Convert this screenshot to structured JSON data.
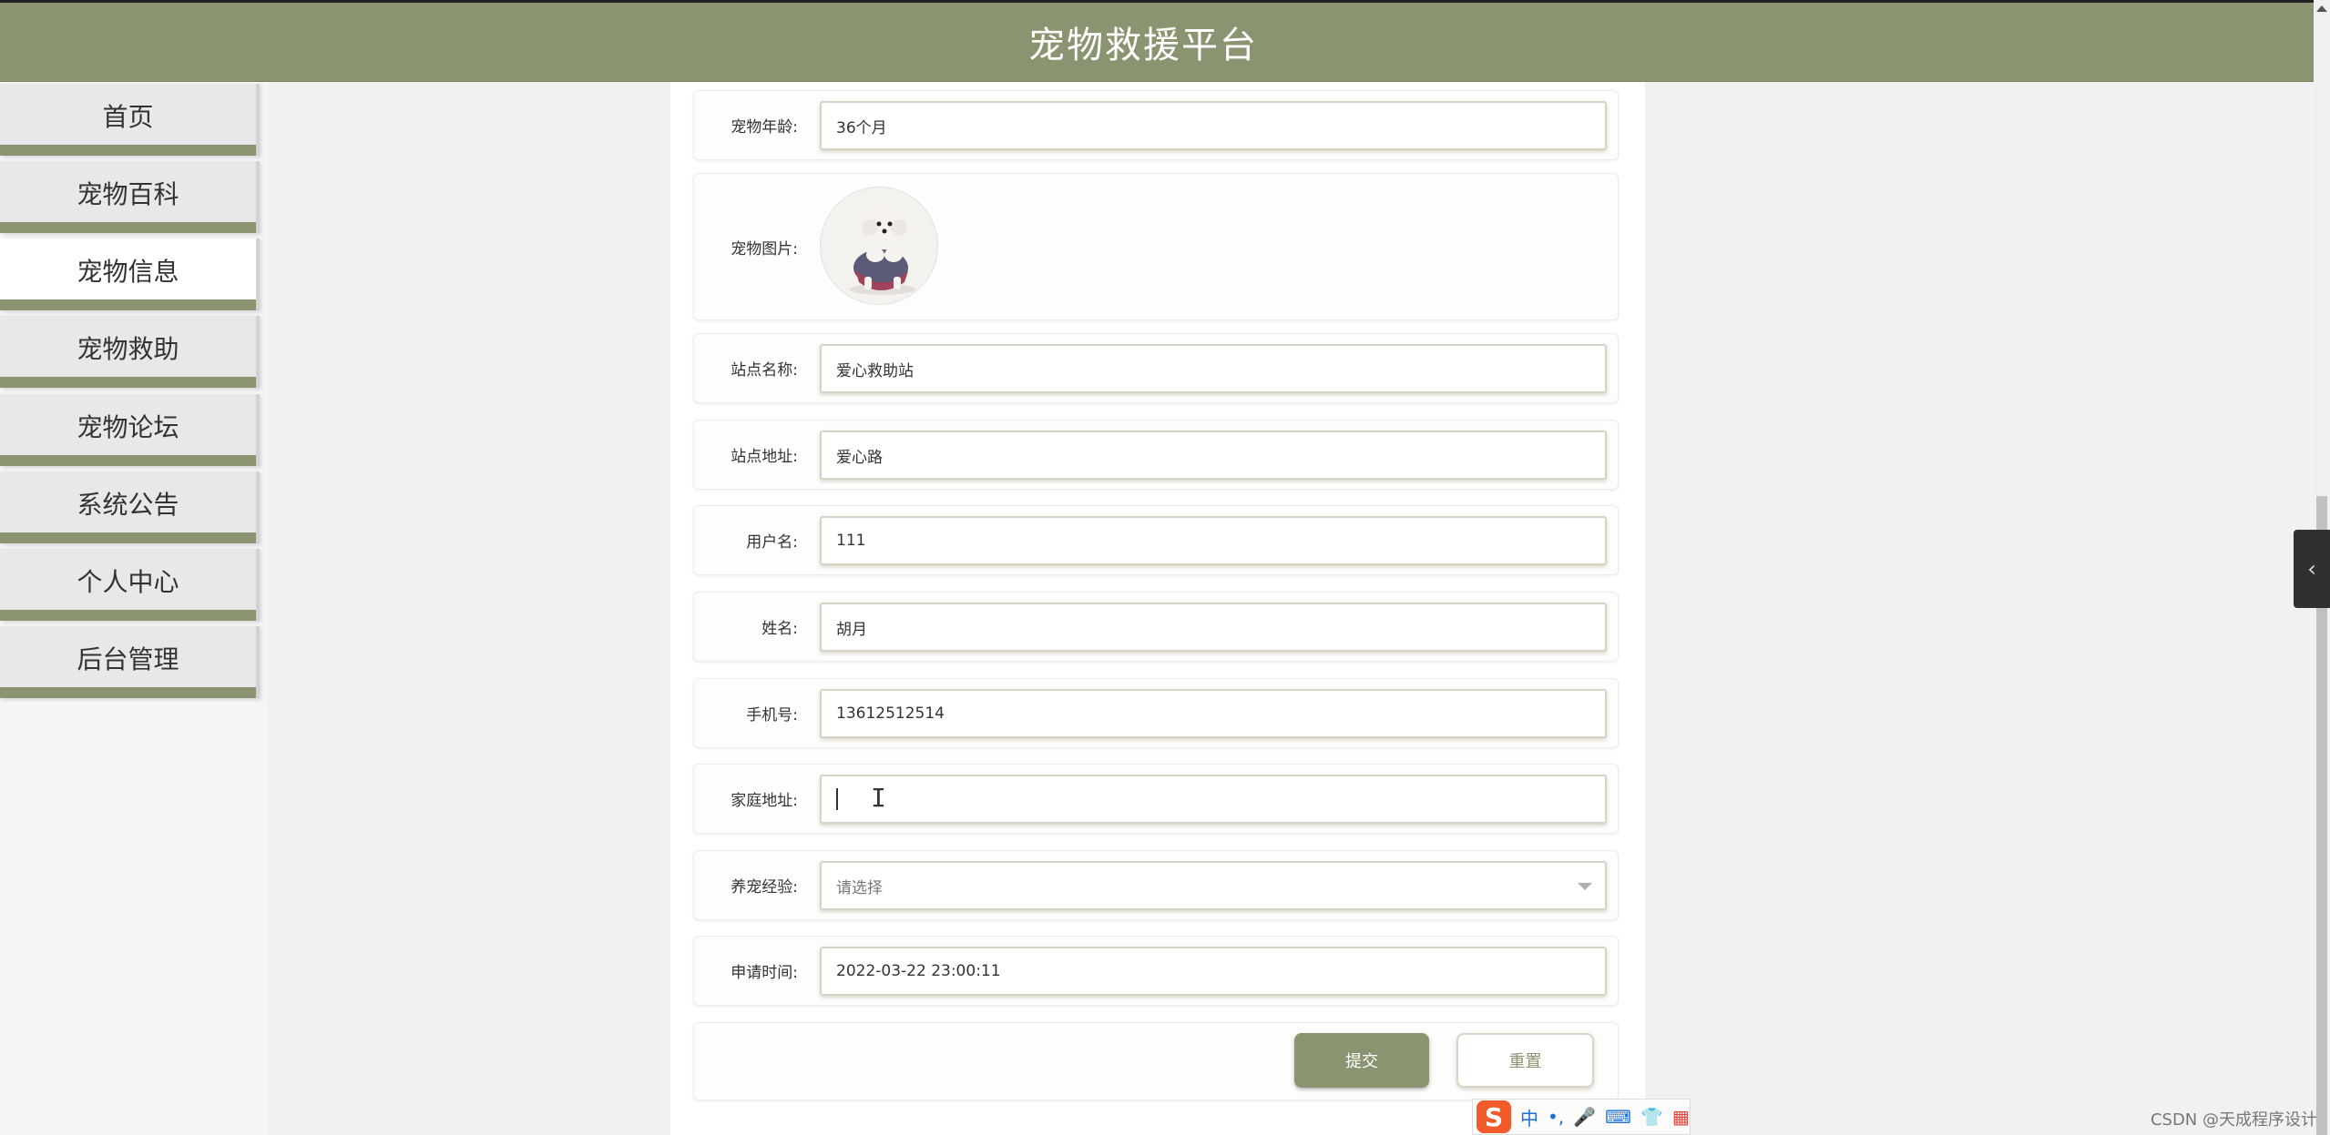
{
  "header": {
    "title": "宠物救援平台"
  },
  "sidebar": {
    "items": [
      {
        "label": "首页"
      },
      {
        "label": "宠物百科"
      },
      {
        "label": "宠物信息",
        "active": true
      },
      {
        "label": "宠物救助"
      },
      {
        "label": "宠物论坛"
      },
      {
        "label": "系统公告"
      },
      {
        "label": "个人中心"
      },
      {
        "label": "后台管理"
      }
    ]
  },
  "form": {
    "pet_age": {
      "label": "宠物年龄:",
      "value": "36个月"
    },
    "pet_image": {
      "label": "宠物图片:"
    },
    "station_name": {
      "label": "站点名称:",
      "value": "爱心救助站"
    },
    "station_address": {
      "label": "站点地址:",
      "value": "爱心路"
    },
    "username": {
      "label": "用户名:",
      "value": "111"
    },
    "name": {
      "label": "姓名:",
      "value": "胡月"
    },
    "phone": {
      "label": "手机号:",
      "value": "13612512514"
    },
    "home_address": {
      "label": "家庭地址:",
      "value": ""
    },
    "experience": {
      "label": "养宠经验:",
      "placeholder": "请选择"
    },
    "apply_time": {
      "label": "申请时间:",
      "value": "2022-03-22 23:00:11"
    }
  },
  "buttons": {
    "submit": "提交",
    "reset": "重置"
  },
  "ime": {
    "logo": "S",
    "lang": "中",
    "punct": "•,",
    "mic": "🎤",
    "keyboard": "⌨",
    "skin": "👕",
    "apps": "▦"
  },
  "watermark": "CSDN @天成程序设计",
  "colors": {
    "accent": "#8b9470",
    "background": "#f1f1f3"
  }
}
